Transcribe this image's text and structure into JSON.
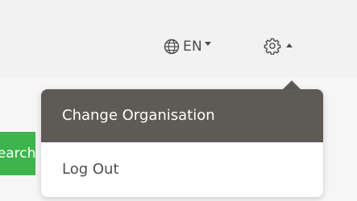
{
  "header": {
    "language": {
      "label": "EN",
      "icon": "globe-icon"
    },
    "settings": {
      "icon": "gear-icon",
      "expanded_indicator": "caret-up-icon"
    }
  },
  "search_button": {
    "label": "Search"
  },
  "dropdown": {
    "items": [
      {
        "label": "Change Organisation",
        "highlighted": true
      },
      {
        "label": "Log Out",
        "highlighted": false
      }
    ]
  },
  "colors": {
    "menu_active_bg": "#5e5a56",
    "search_green": "#3db54a",
    "text_dark": "#4a4a4a"
  }
}
